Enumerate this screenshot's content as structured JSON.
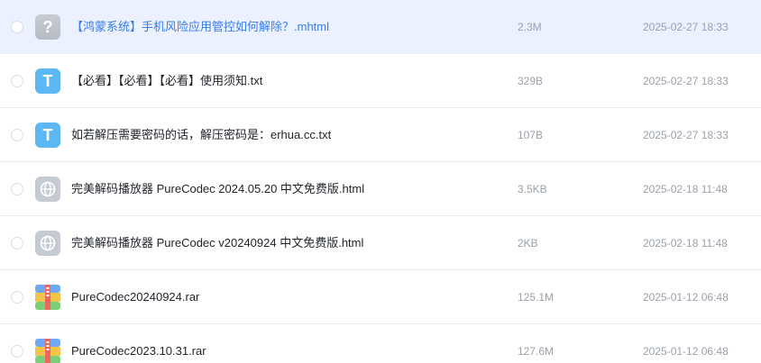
{
  "files": [
    {
      "name": "【鸿蒙系统】手机风险应用管控如何解除？.mhtml",
      "size": "2.3M",
      "date": "2025-02-27 18:33",
      "icon": "unknown-file-icon",
      "icon_glyph": "?"
    },
    {
      "name": "【必看】【必看】【必看】使用须知.txt",
      "size": "329B",
      "date": "2025-02-27 18:33",
      "icon": "text-file-icon",
      "icon_glyph": "T"
    },
    {
      "name": "如若解压需要密码的话，解压密码是：erhua.cc.txt",
      "size": "107B",
      "date": "2025-02-27 18:33",
      "icon": "text-file-icon",
      "icon_glyph": "T"
    },
    {
      "name": "完美解码播放器 PureCodec 2024.05.20 中文免费版.html",
      "size": "3.5KB",
      "date": "2025-02-18 11:48",
      "icon": "globe-icon"
    },
    {
      "name": "完美解码播放器 PureCodec v20240924 中文免费版.html",
      "size": "2KB",
      "date": "2025-02-18 11:48",
      "icon": "globe-icon"
    },
    {
      "name": "PureCodec20240924.rar",
      "size": "125.1M",
      "date": "2025-01-12 06:48",
      "icon": "archive-icon"
    },
    {
      "name": "PureCodec2023.10.31.rar",
      "size": "127.6M",
      "date": "2025-01-12 06:48",
      "icon": "archive-icon"
    }
  ],
  "colors": {
    "hover_row": "#ebf1fe",
    "hover_text": "#3b7ce8",
    "text_icon": "#5cb7f2",
    "muted": "#9aa0aa"
  }
}
